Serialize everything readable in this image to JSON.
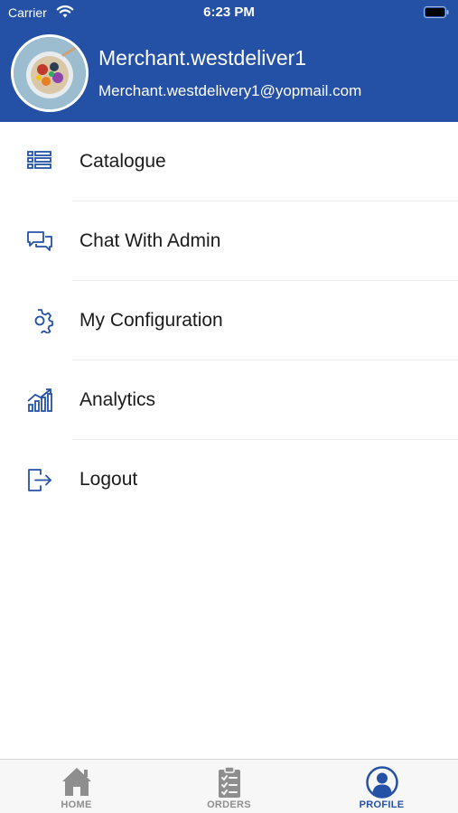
{
  "status_bar": {
    "carrier": "Carrier",
    "time": "6:23 PM"
  },
  "profile": {
    "name": "Merchant.westdeliver1",
    "email": "Merchant.westdelivery1@yopmail.com",
    "avatar_icon": "food-bowl-photo"
  },
  "colors": {
    "brand": "#2451a6",
    "text": "#1b1b1b",
    "tab_inactive": "#8e8e8e"
  },
  "menu": {
    "items": [
      {
        "label": "Catalogue",
        "icon": "list-icon"
      },
      {
        "label": "Chat With Admin",
        "icon": "chat-icon"
      },
      {
        "label": "My Configuration",
        "icon": "gear-icon"
      },
      {
        "label": "Analytics",
        "icon": "analytics-icon"
      },
      {
        "label": "Logout",
        "icon": "logout-icon"
      }
    ]
  },
  "tabbar": {
    "tabs": [
      {
        "label": "HOME",
        "icon": "home-icon",
        "active": false
      },
      {
        "label": "ORDERS",
        "icon": "clipboard-icon",
        "active": false
      },
      {
        "label": "PROFILE",
        "icon": "profile-icon",
        "active": true
      }
    ]
  }
}
